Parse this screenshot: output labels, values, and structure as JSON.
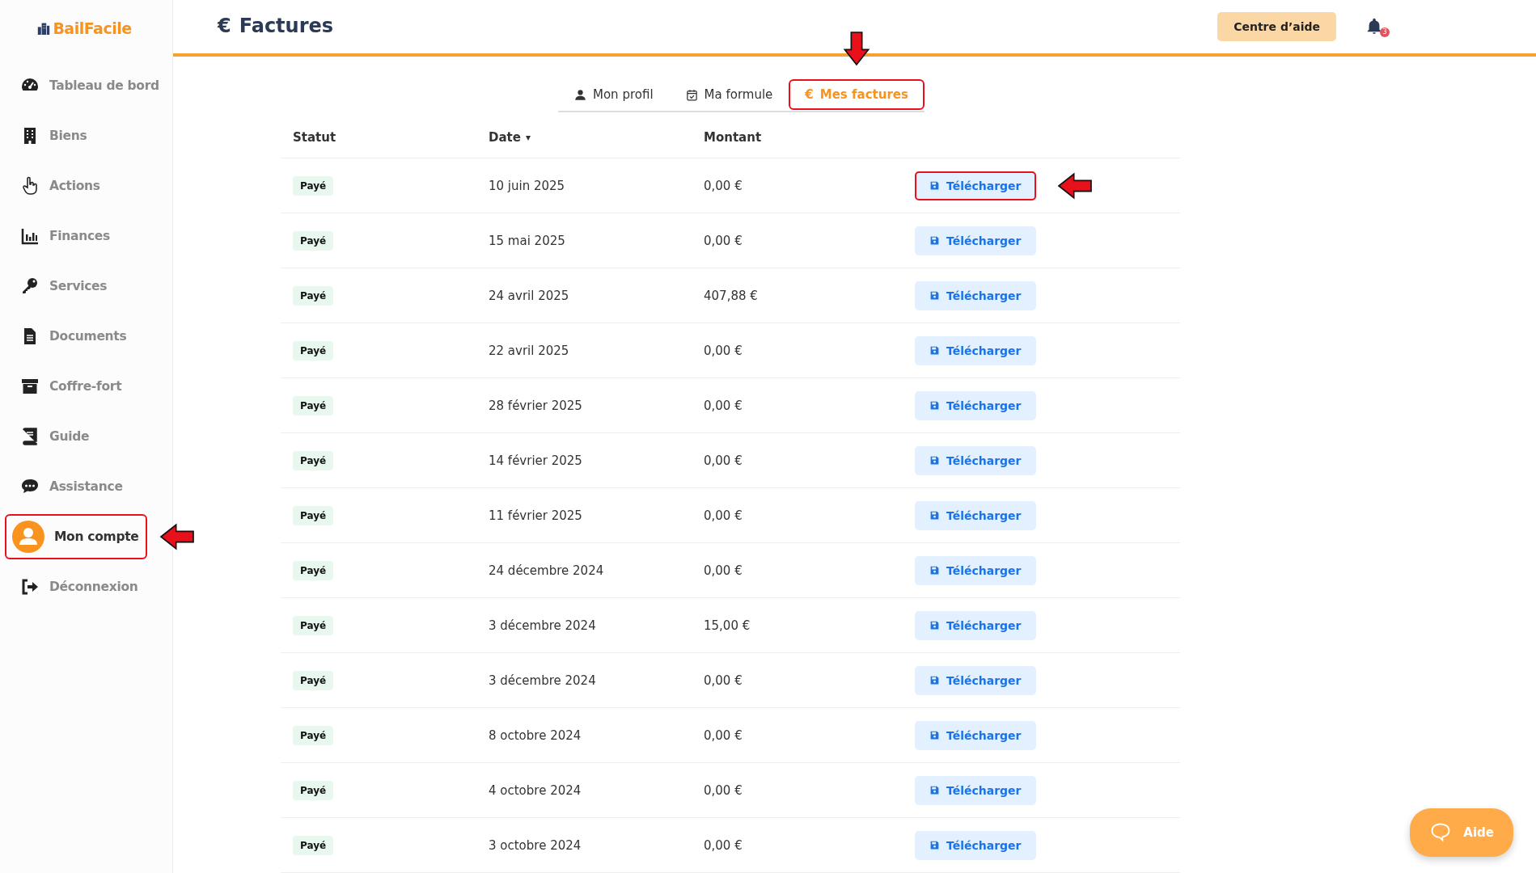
{
  "sidebar": {
    "logo": "BailFacile",
    "items": [
      {
        "label": "Tableau de bord",
        "selected": false,
        "highlighted": false
      },
      {
        "label": "Biens",
        "selected": false,
        "highlighted": false
      },
      {
        "label": "Actions",
        "selected": false,
        "highlighted": false
      },
      {
        "label": "Finances",
        "selected": false,
        "highlighted": false
      },
      {
        "label": "Services",
        "selected": false,
        "highlighted": false
      },
      {
        "label": "Documents",
        "selected": false,
        "highlighted": false
      },
      {
        "label": "Coffre-fort",
        "selected": false,
        "highlighted": false
      },
      {
        "label": "Guide",
        "selected": false,
        "highlighted": false
      },
      {
        "label": "Assistance",
        "selected": false,
        "highlighted": false
      },
      {
        "label": "Mon compte",
        "selected": true,
        "highlighted": true
      },
      {
        "label": "Déconnexion",
        "selected": false,
        "highlighted": false
      }
    ]
  },
  "header": {
    "icon": "€",
    "title": "Factures",
    "help_button": "Centre d’aide",
    "notifications": "3"
  },
  "tabs": [
    {
      "label": "Mon profil",
      "selected": false,
      "highlighted": false
    },
    {
      "label": "Ma formule",
      "selected": false,
      "highlighted": false
    },
    {
      "label": "Mes factures",
      "icon": "€",
      "selected": true,
      "highlighted": true
    }
  ],
  "table": {
    "columns": [
      "Statut",
      "Date",
      "Montant"
    ],
    "sort_icon": "▾",
    "rows": [
      {
        "status": "Payé",
        "date": "10 juin 2025",
        "amount": "0,00 €",
        "button": "Télécharger",
        "highlighted": true
      },
      {
        "status": "Payé",
        "date": "15 mai 2025",
        "amount": "0,00 €",
        "button": "Télécharger",
        "highlighted": false
      },
      {
        "status": "Payé",
        "date": "24 avril 2025",
        "amount": "407,88 €",
        "button": "Télécharger",
        "highlighted": false
      },
      {
        "status": "Payé",
        "date": "22 avril 2025",
        "amount": "0,00 €",
        "button": "Télécharger",
        "highlighted": false
      },
      {
        "status": "Payé",
        "date": "28 février 2025",
        "amount": "0,00 €",
        "button": "Télécharger",
        "highlighted": false
      },
      {
        "status": "Payé",
        "date": "14 février 2025",
        "amount": "0,00 €",
        "button": "Télécharger",
        "highlighted": false
      },
      {
        "status": "Payé",
        "date": "11 février 2025",
        "amount": "0,00 €",
        "button": "Télécharger",
        "highlighted": false
      },
      {
        "status": "Payé",
        "date": "24 décembre 2024",
        "amount": "0,00 €",
        "button": "Télécharger",
        "highlighted": false
      },
      {
        "status": "Payé",
        "date": "3 décembre 2024",
        "amount": "15,00 €",
        "button": "Télécharger",
        "highlighted": false
      },
      {
        "status": "Payé",
        "date": "3 décembre 2024",
        "amount": "0,00 €",
        "button": "Télécharger",
        "highlighted": false
      },
      {
        "status": "Payé",
        "date": "8 octobre 2024",
        "amount": "0,00 €",
        "button": "Télécharger",
        "highlighted": false
      },
      {
        "status": "Payé",
        "date": "4 octobre 2024",
        "amount": "0,00 €",
        "button": "Télécharger",
        "highlighted": false
      },
      {
        "status": "Payé",
        "date": "3 octobre 2024",
        "amount": "0,00 €",
        "button": "Télécharger",
        "highlighted": false
      }
    ]
  },
  "help_widget": {
    "label": "Aide"
  }
}
